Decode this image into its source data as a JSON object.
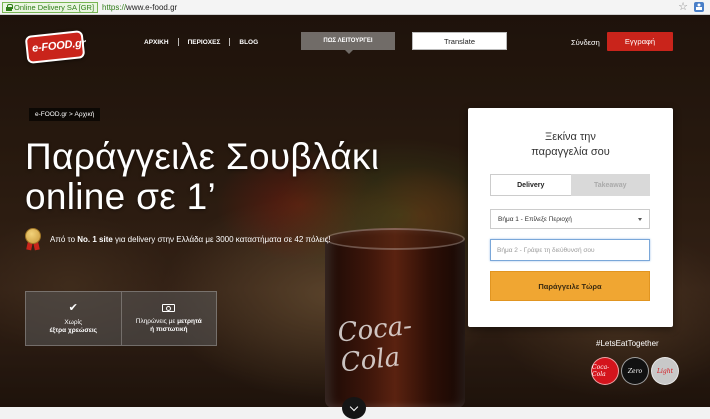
{
  "browser": {
    "secure_label": "Online Delivery SA [GR]",
    "url_scheme": "https://",
    "url_host": "www.e-food.gr"
  },
  "header": {
    "logo_text": "e-FOOD.gr",
    "nav": [
      {
        "label": "ΑΡΧΙΚΗ"
      },
      {
        "label": "ΠΕΡΙΟΧΕΣ"
      },
      {
        "label": "BLOG"
      }
    ],
    "how_it_works": "ΠΩΣ ΛΕΙΤΟΥΡΓΕΙ",
    "translate": "Translate",
    "login": "Σύνδεση",
    "signup": "Εγγραφή"
  },
  "hero": {
    "breadcrumb": "e-FOOD.gr > Αρχική",
    "headline": "Παράγγειλε Σουβλάκι online σε 1’",
    "tagline_pre": "Από το ",
    "tagline_bold": "No. 1 site",
    "tagline_post": " για delivery στην Ελλάδα με 3000 καταστήματα σε 42 πόλεις!",
    "features": [
      {
        "icon": "check-icon",
        "line1": "Χωρίς",
        "line2": "έξτρα χρεώσεις"
      },
      {
        "icon": "cash-icon",
        "line1_pre": "Πληρώνεις με ",
        "line1_bold": "μετρητά",
        "line2": "ή πιστωτική"
      }
    ],
    "glass_logo": "Coca-Cola",
    "hashtag": "#LetsEatTogether",
    "cans": [
      "Coca-Cola",
      "Zero",
      "Light"
    ]
  },
  "order_panel": {
    "title_accent": "Ξεκίνα",
    "title_rest": " την",
    "title_line2": "παραγγελία σου",
    "tabs": [
      {
        "label": "Delivery",
        "active": true
      },
      {
        "label": "Takeaway",
        "active": false
      }
    ],
    "step1": "Βήμα 1 - Επίλεξε Περιοχή",
    "step2_placeholder": "Βήμα 2 - Γράψε τη διεύθυνσή σου",
    "step2_value": "",
    "cta": "Παράγγειλε Τώρα"
  },
  "colors": {
    "brand_red": "#c9241b",
    "cta_orange": "#f0a632"
  }
}
